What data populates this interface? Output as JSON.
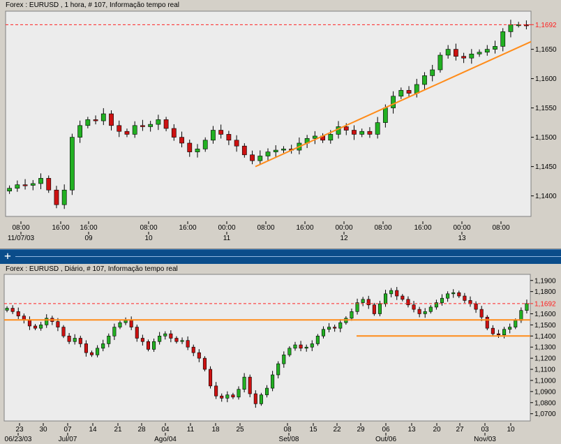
{
  "top": {
    "title": "Forex : EURUSD , 1 hora, # 107, Informação tempo real",
    "price_current": "1,1692",
    "price_labels": [
      "1,1650",
      "1,1600",
      "1,1550",
      "1,1500",
      "1,1450",
      "1,1400"
    ],
    "time_labels": [
      "08:00",
      "16:00",
      "16:00",
      "08:00",
      "16:00",
      "00:00",
      "08:00",
      "16:00",
      "00:00",
      "08:00",
      "16:00",
      "00:00",
      "08:00"
    ],
    "date_labels": [
      "11/07/03",
      "09",
      "10",
      "11",
      "12",
      "13"
    ],
    "ylim": [
      1.1365,
      1.1715
    ]
  },
  "bottom": {
    "title": "Forex : EURUSD , Diário, # 107, Informação tempo real",
    "price_current": "1,1692",
    "price_labels": [
      "1,1900",
      "1,1800",
      "1,1600",
      "1,1500",
      "1,1400",
      "1,1300",
      "1,1200",
      "1,1100",
      "1,1000",
      "1,0900",
      "1,0800",
      "1,0700"
    ],
    "day_labels": [
      "23",
      "30",
      "07",
      "14",
      "21",
      "28",
      "04",
      "11",
      "18",
      "25",
      "08",
      "15",
      "22",
      "29",
      "06",
      "13",
      "20",
      "27",
      "03",
      "10"
    ],
    "month_labels": [
      "06/23/03",
      "Jul/07",
      "Ago/04",
      "Set/08",
      "Out/06",
      "Nov/03"
    ],
    "ylim": [
      1.0635,
      1.1955
    ]
  },
  "colors": {
    "bull": "#22b022",
    "bear": "#cc1111",
    "trendline": "#ff8c1a",
    "current_price": "#ff2020",
    "divider": "#0a4c8a"
  },
  "chart_data": [
    {
      "type": "candlestick",
      "title": "Forex : EURUSD , 1 hora, # 107, Informação tempo real",
      "ylim": [
        1.1365,
        1.1715
      ],
      "series": [
        {
          "name": "EURUSD",
          "close_sampled": [
            1.1413,
            1.1419,
            1.1418,
            1.1421,
            1.143,
            1.141,
            1.1385,
            1.141,
            1.15,
            1.152,
            1.153,
            1.1528,
            1.154,
            1.152,
            1.151,
            1.1505,
            1.152,
            1.1518,
            1.1522,
            1.153,
            1.1515,
            1.15,
            1.149,
            1.1475,
            1.148,
            1.1495,
            1.1512,
            1.1505,
            1.1495,
            1.1485,
            1.147,
            1.146,
            1.1468,
            1.1475,
            1.1478,
            1.148,
            1.1478,
            1.149,
            1.1498,
            1.1502,
            1.1495,
            1.1505,
            1.1518,
            1.1512,
            1.1505,
            1.151,
            1.1505,
            1.1525,
            1.155,
            1.157,
            1.158,
            1.1575,
            1.159,
            1.1605,
            1.1615,
            1.164,
            1.165,
            1.1638,
            1.1635,
            1.1642,
            1.1645,
            1.165,
            1.1655,
            1.168,
            1.1692,
            1.1692,
            1.169
          ]
        }
      ],
      "annotations": [
        {
          "type": "horizontal_line",
          "y": 1.1692,
          "style": "dashed"
        },
        {
          "type": "trendline",
          "from": 1.145,
          "to": 1.1663
        }
      ]
    },
    {
      "type": "candlestick",
      "title": "Forex : EURUSD , Diário, # 107, Informação tempo real",
      "ylim": [
        1.0635,
        1.1955
      ],
      "series": [
        {
          "name": "EURUSD",
          "close_sampled": [
            1.165,
            1.162,
            1.158,
            1.1545,
            1.149,
            1.147,
            1.15,
            1.156,
            1.153,
            1.148,
            1.14,
            1.135,
            1.138,
            1.133,
            1.125,
            1.123,
            1.129,
            1.133,
            1.14,
            1.148,
            1.152,
            1.154,
            1.148,
            1.138,
            1.135,
            1.128,
            1.135,
            1.14,
            1.142,
            1.138,
            1.135,
            1.136,
            1.13,
            1.125,
            1.12,
            1.11,
            1.095,
            1.086,
            1.084,
            1.087,
            1.085,
            1.092,
            1.103,
            1.088,
            1.079,
            1.087,
            1.093,
            1.105,
            1.115,
            1.123,
            1.129,
            1.132,
            1.129,
            1.13,
            1.133,
            1.14,
            1.146,
            1.148,
            1.147,
            1.152,
            1.156,
            1.162,
            1.17,
            1.173,
            1.168,
            1.16,
            1.169,
            1.178,
            1.181,
            1.176,
            1.173,
            1.168,
            1.164,
            1.16,
            1.162,
            1.166,
            1.17,
            1.174,
            1.178,
            1.179,
            1.176,
            1.172,
            1.169,
            1.164,
            1.157,
            1.147,
            1.142,
            1.141,
            1.146,
            1.148,
            1.154,
            1.163,
            1.1692
          ]
        }
      ],
      "annotations": [
        {
          "type": "horizontal_line",
          "y": 1.1692,
          "style": "dashed"
        },
        {
          "type": "horizontal_line",
          "y": 1.1545,
          "style": "solid"
        },
        {
          "type": "horizontal_line",
          "y": 1.14,
          "style": "solid"
        }
      ]
    }
  ]
}
